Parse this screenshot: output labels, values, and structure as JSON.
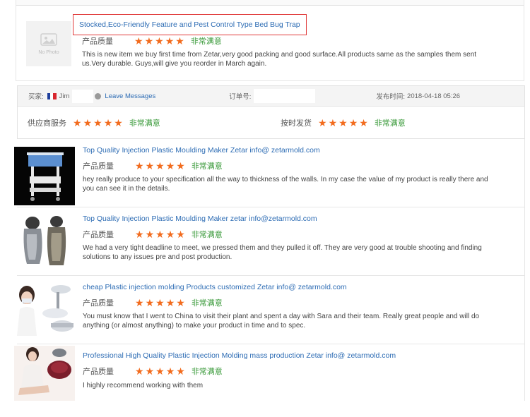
{
  "top_review": {
    "no_photo_label": "No Photo",
    "title": "Stocked,Eco-Friendly Feature and Pest Control Type Bed Bug Trap",
    "rating_label": "产品质量",
    "rating_text": "非常满意",
    "comment": "This is new item we buy first time from Zetar,very good packing and good surface.All products same as the samples them sent us.Very durable. Guys,will give you reorder in March again."
  },
  "buyer_bar": {
    "buyer_label": "买家:",
    "buyer_name": "Jim",
    "leave_messages": "Leave Messages",
    "order_label": "订单号:",
    "published_label": "发布时间:",
    "published_time": "2018-04-18 05:26"
  },
  "service": {
    "supplier_label": "供应商服务",
    "supplier_text": "非常满意",
    "shipping_label": "按时发货",
    "shipping_text": "非常满意"
  },
  "colors": {
    "link": "#2d6cb4",
    "star": "#f26b1d",
    "satisfied": "#3a9a3a",
    "highlight_border": "#e03a3a"
  },
  "products": [
    {
      "title": "Top Quality Injection Plastic Moulding Maker Zetar info@ zetarmold.com",
      "rating_label": "产品质量",
      "rating_text": "非常满意",
      "comment": "hey really produce to your specification all the way to thickness of the walls. In my case the value of my product is really there and you can see it in the details.",
      "thumb": "medical-trolley-image"
    },
    {
      "title": "Top Quality Injection Plastic Moulding Maker zetar info@zetarmold.com",
      "rating_label": "产品质量",
      "rating_text": "非常满意",
      "comment": "We had a very tight deadline to meet, we pressed them and they pulled it off. They are very good at trouble shooting and finding solutions to any issues pre and post production.",
      "thumb": "beauty-machine-image"
    },
    {
      "title": "cheap Plastic injection molding Products customized Zetar info@ zetarmold.com",
      "rating_label": "产品质量",
      "rating_text": "非常满意",
      "comment": "You must know that I went to China to visit their plant and spent a day with Sara and their team. Really great people and will do anything (or almost anything) to make your product in time and to spec.",
      "thumb": "nurse-device-image"
    },
    {
      "title": "Professional High Quality Plastic Injection Molding mass production Zetar info@ zetarmold.com",
      "rating_label": "产品质量",
      "rating_text": "非常满意",
      "comment": "I highly recommend working with them",
      "thumb": "foot-massager-image"
    }
  ]
}
